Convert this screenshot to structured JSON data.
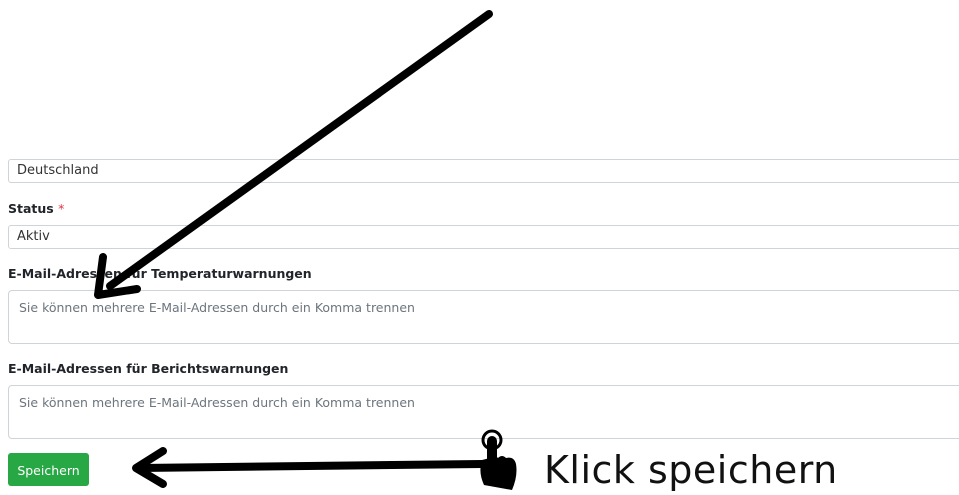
{
  "form": {
    "country_value": "Deutschland",
    "status_label": "Status",
    "required_marker": "*",
    "status_value": "Aktiv",
    "temp_emails_label": "E-Mail-Adressen für Temperaturwarnungen",
    "temp_emails_placeholder": "Sie können mehrere E-Mail-Adressen durch ein Komma trennen",
    "report_emails_label": "E-Mail-Adressen für Berichtswarnungen",
    "report_emails_placeholder": "Sie können mehrere E-Mail-Adressen durch ein Komma trennen",
    "save_label": "Speichern"
  },
  "annotation": {
    "callout_text": "Klick speichern"
  },
  "colors": {
    "save_button": "#28a745",
    "required": "#dc3545",
    "arrow": "#000000"
  }
}
